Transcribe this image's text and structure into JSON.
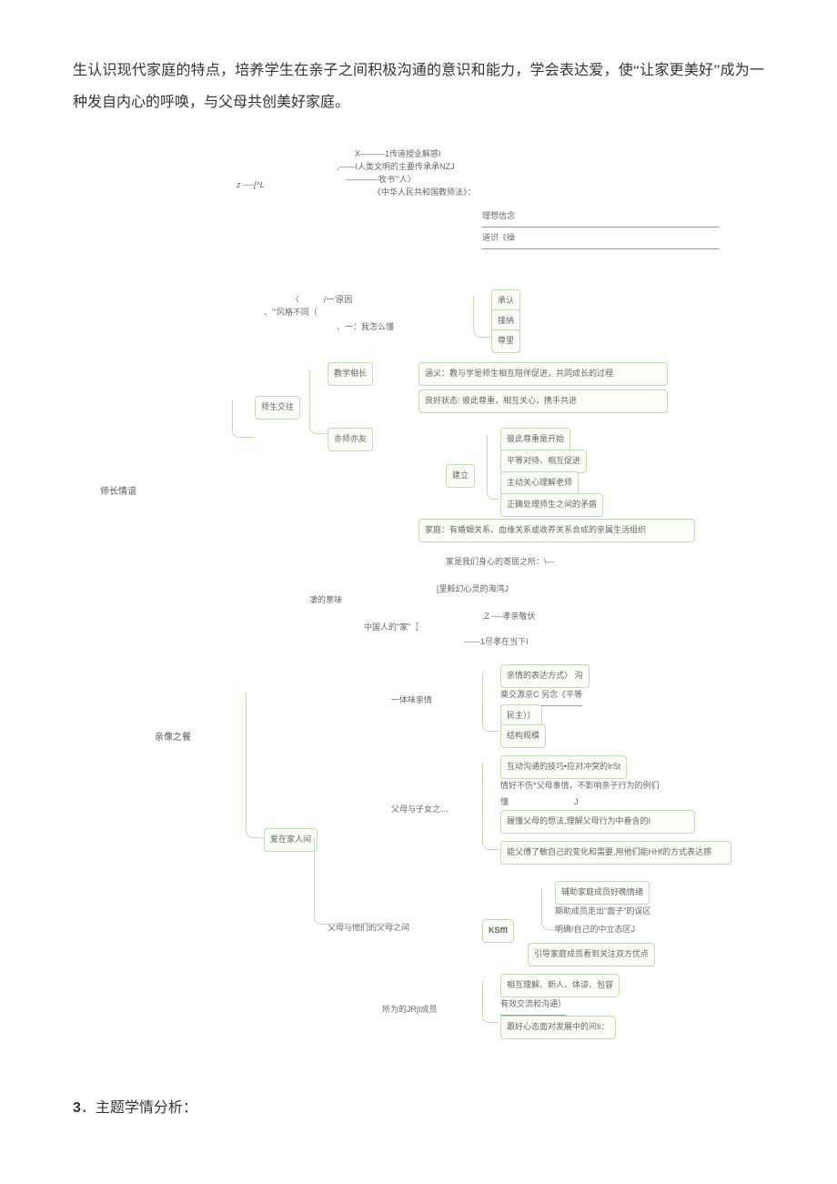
{
  "paragraph": "生认识现代家庭的特点，培养学生在亲子之间积极沟通的意识和能力，学会表达爱，使“让家更美好”成为一种发自内心的呼唤，与父母共创美好家庭。",
  "diagram": {
    "top_note1": "X———1传道授业解惑I",
    "top_note2": ",——I人类文明的主要传承承NZJ",
    "top_note3": "z ----[^L",
    "top_note4": "————牧书\"'人〉",
    "top_note5": "《中华人民共和国教师法》：",
    "ideal": "理想信念",
    "moral": "道识《操",
    "reason_hdr": "〈　　　/一'原因",
    "style_diff": "、\"'风格不同（",
    "how_understand": "、一：我怎么懂",
    "ack": "承认",
    "accept": "接纳",
    "respect": "尊里",
    "root1": "师长情谊",
    "teach_learn": "教学相长",
    "teach_learn_def": "涵义：教与学是师生相互陪伴促进，共同成长的过程",
    "teacher_student": "师生交往",
    "good_state": "良好状态: 彼此尊重，相互关心，携手共进",
    "both_teacher_friend": "亦师亦友",
    "build": "建立",
    "b1": "彼此尊重是开始",
    "b2": "平等对待、相互促进",
    "b3": "主动关心理解老师",
    "b4": "正确处理师生之间的矛盾",
    "family_def": "家庭：有婚姻关系、血缘关系或收养关系合成的亲属生活组织",
    "home_place": "家是我们身心的寄居之所：\\—",
    "home_taste": "凄的意味",
    "soul_bay": "[里毅幻心灵的海湾J",
    "chinese_home": "中国人的\"家\"［",
    "z_xiao": ",Z ----孝亲敬伏",
    "xiao_now": "------1尽孝在当下I",
    "root2": "亲像之餐",
    "taste_affection": "一体味亲情",
    "a1": "亲情的表达方式〉 沟",
    "a2": "奠交源京C 另念《平等",
    "a3": "民主））",
    "a4": "结构规模",
    "love_home": "爱在家人间",
    "parent_child": "父母与子女之…",
    "p1": "互动沟通的技巧•应对冲突的IrSt",
    "p2": "情好不伤*父母事情，不影响亲子行为的例们",
    "p2b": "懂　　　　　　　　J",
    "p3": "履懂父母的想法,理解父母行为中眷含的I",
    "p4": "能父傅了敏自己的变化和需要,用他们能HHf的方式表达感",
    "parent_grandparent": "父母与他们的父母之间",
    "ksffi": "KSffI",
    "g1": "辅助家庭成员好晚情绪",
    "g2": "期助成员走出\"面子\"的误区",
    "g3": "明确!自己的中立态区J",
    "g4": "引导家庭成员看到关注双方优点",
    "all_members": "所为的JRjI成员",
    "m1": "相互理解、新人、体谅、包容",
    "m2": "有效交流和沟通）",
    "m3": "跟好心态面对发展中的问Ii："
  },
  "heading_num": "3",
  "heading_text": "．主题学情分析："
}
